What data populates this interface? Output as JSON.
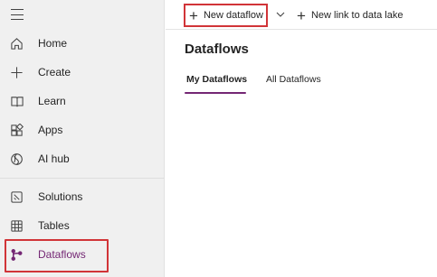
{
  "sidebar": {
    "items": [
      {
        "label": "Home",
        "icon": "home-icon"
      },
      {
        "label": "Create",
        "icon": "plus-icon"
      },
      {
        "label": "Learn",
        "icon": "book-icon"
      },
      {
        "label": "Apps",
        "icon": "apps-icon"
      },
      {
        "label": "AI hub",
        "icon": "ai-hub-icon"
      },
      {
        "label": "Solutions",
        "icon": "solutions-icon"
      },
      {
        "label": "Tables",
        "icon": "table-icon"
      },
      {
        "label": "Dataflows",
        "icon": "dataflow-icon"
      }
    ],
    "selected": "Dataflows"
  },
  "toolbar": {
    "new_dataflow_label": "New dataflow",
    "new_link_label": "New link to data lake"
  },
  "main": {
    "title": "Dataflows",
    "tabs": [
      {
        "label": "My Dataflows",
        "active": true
      },
      {
        "label": "All Dataflows",
        "active": false
      }
    ]
  },
  "colors": {
    "accent": "#742774",
    "highlight": "#d13438",
    "sidebar_bg": "#f0f0f0"
  }
}
